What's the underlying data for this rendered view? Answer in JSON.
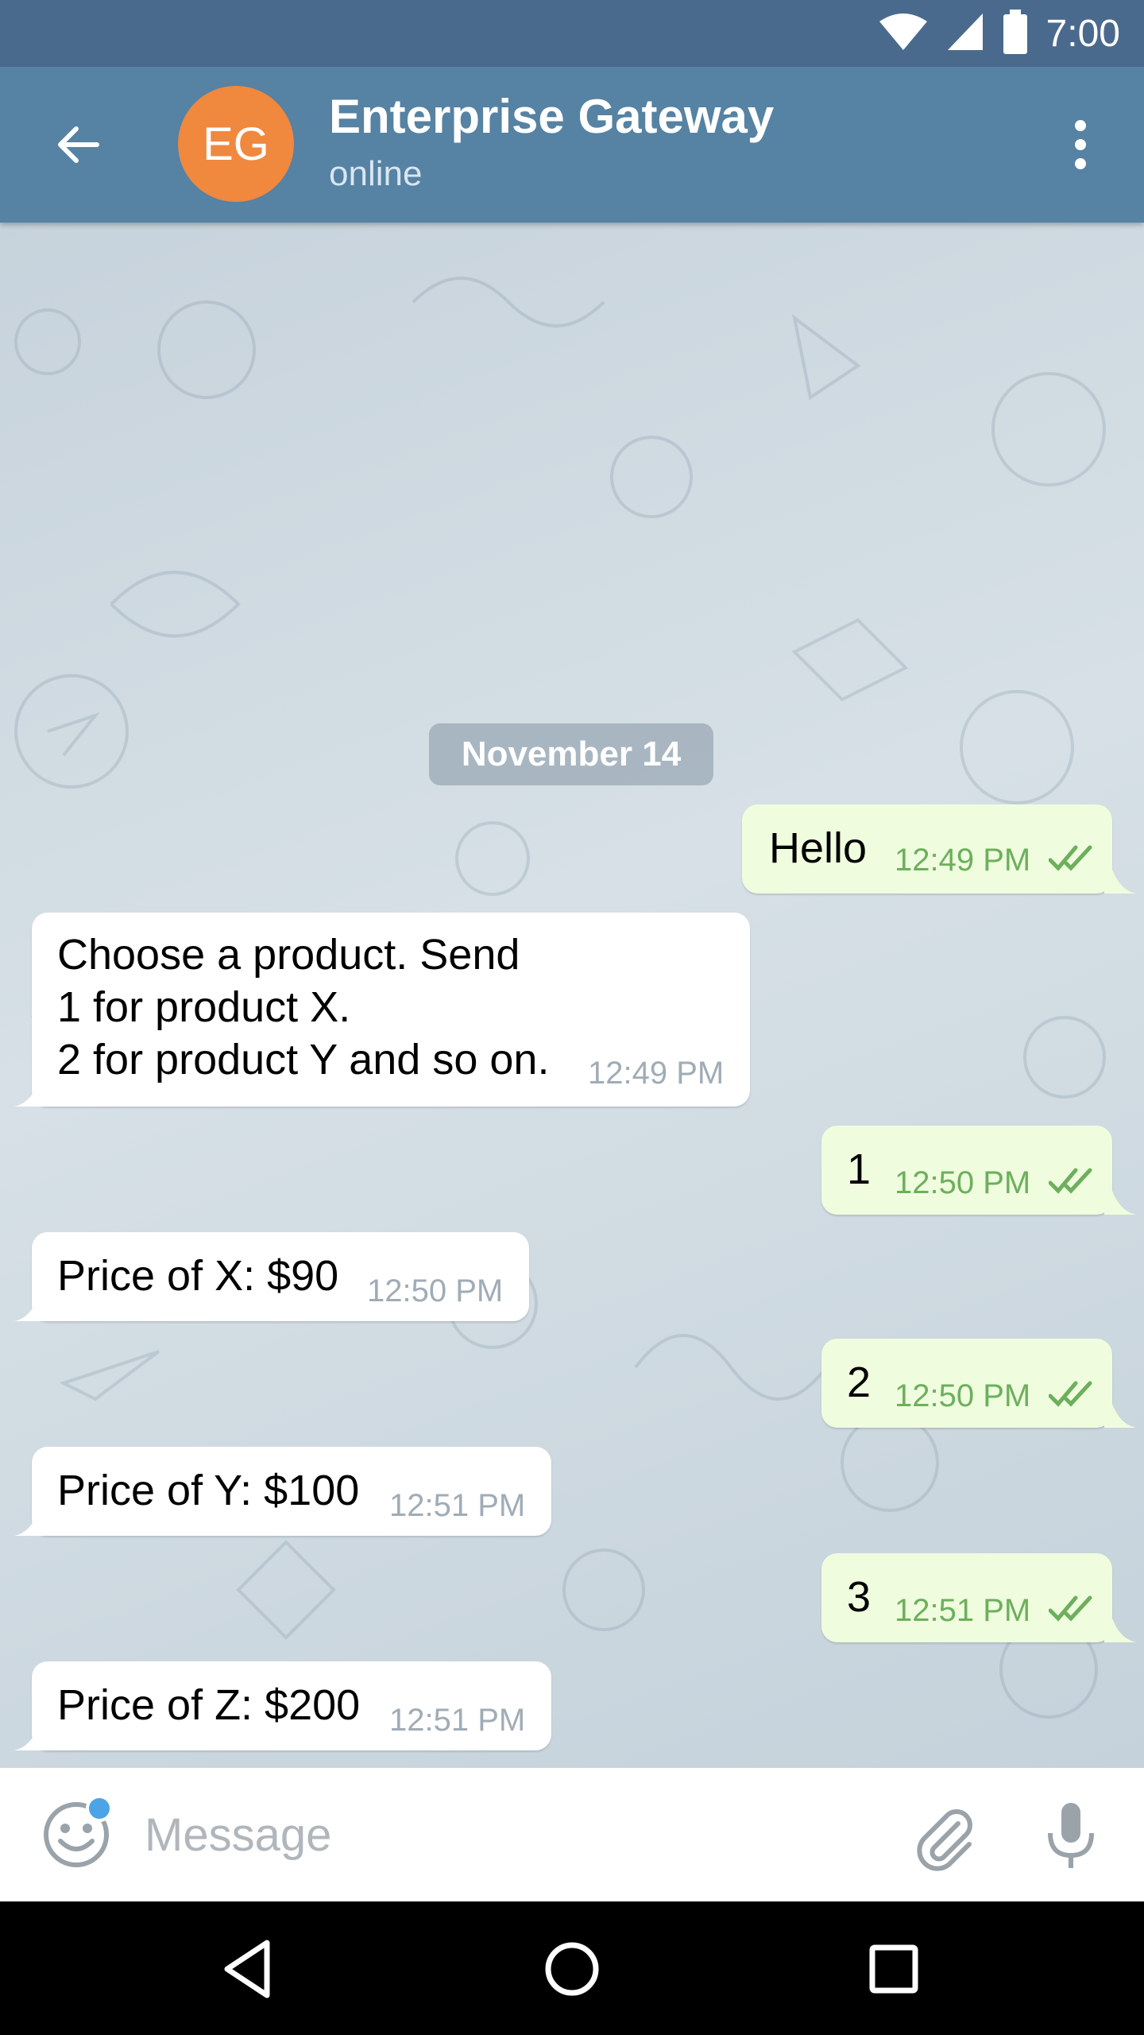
{
  "status_bar": {
    "time": "7:00"
  },
  "header": {
    "avatar_initials": "EG",
    "avatar_color": "#f0883e",
    "title": "Enterprise Gateway",
    "subtitle": "online"
  },
  "chat": {
    "date_chip": "November 14",
    "messages": [
      {
        "direction": "out",
        "text": "Hello",
        "time": "12:49 PM",
        "read": true
      },
      {
        "direction": "in",
        "text": "Choose a product. Send\n1 for product X.\n2 for product Y and so on.",
        "time": "12:49 PM"
      },
      {
        "direction": "out",
        "text": "1",
        "time": "12:50 PM",
        "read": true
      },
      {
        "direction": "in",
        "text": "Price of X: $90",
        "time": "12:50 PM"
      },
      {
        "direction": "out",
        "text": "2",
        "time": "12:50 PM",
        "read": true
      },
      {
        "direction": "in",
        "text": "Price of Y: $100",
        "time": "12:51 PM"
      },
      {
        "direction": "out",
        "text": "3",
        "time": "12:51 PM",
        "read": true
      },
      {
        "direction": "in",
        "text": "Price of Z: $200",
        "time": "12:51 PM"
      }
    ]
  },
  "input": {
    "placeholder": "Message",
    "value": ""
  },
  "colors": {
    "header_bg": "#5682a3",
    "status_bar_bg": "#4a6a8d",
    "outgoing_bubble": "#effdde",
    "incoming_bubble": "#ffffff",
    "outgoing_time": "#6daf5d"
  },
  "icons": {
    "back": "arrow-left-icon",
    "menu": "more-vertical-icon",
    "emoji": "smile-icon",
    "attach": "paperclip-icon",
    "mic": "mic-icon",
    "read": "double-check-icon"
  }
}
